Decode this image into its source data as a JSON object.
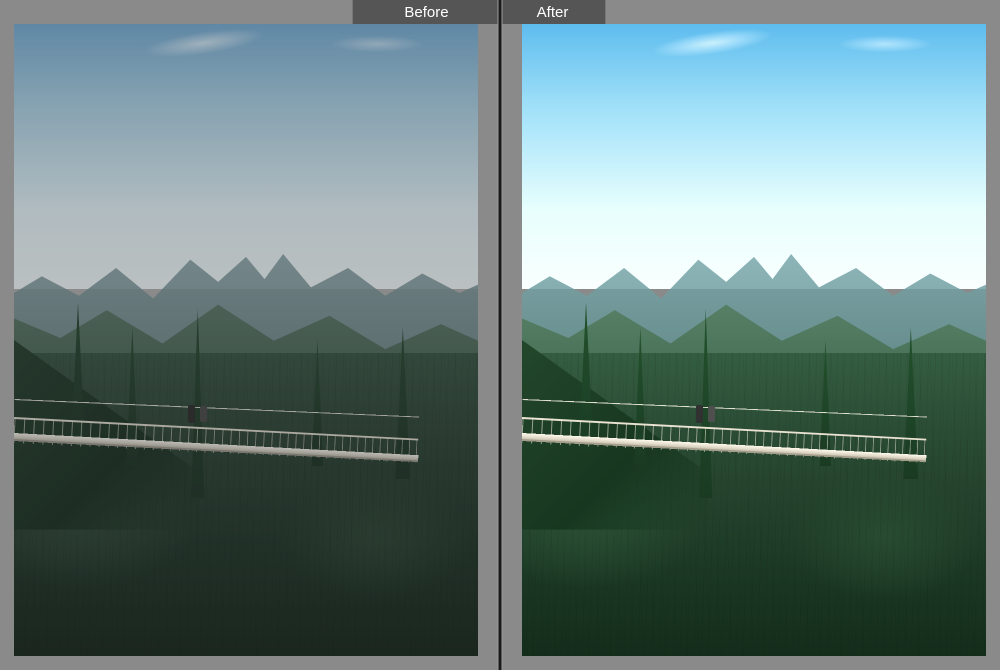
{
  "comparison": {
    "left_label": "Before",
    "right_label": "After"
  }
}
